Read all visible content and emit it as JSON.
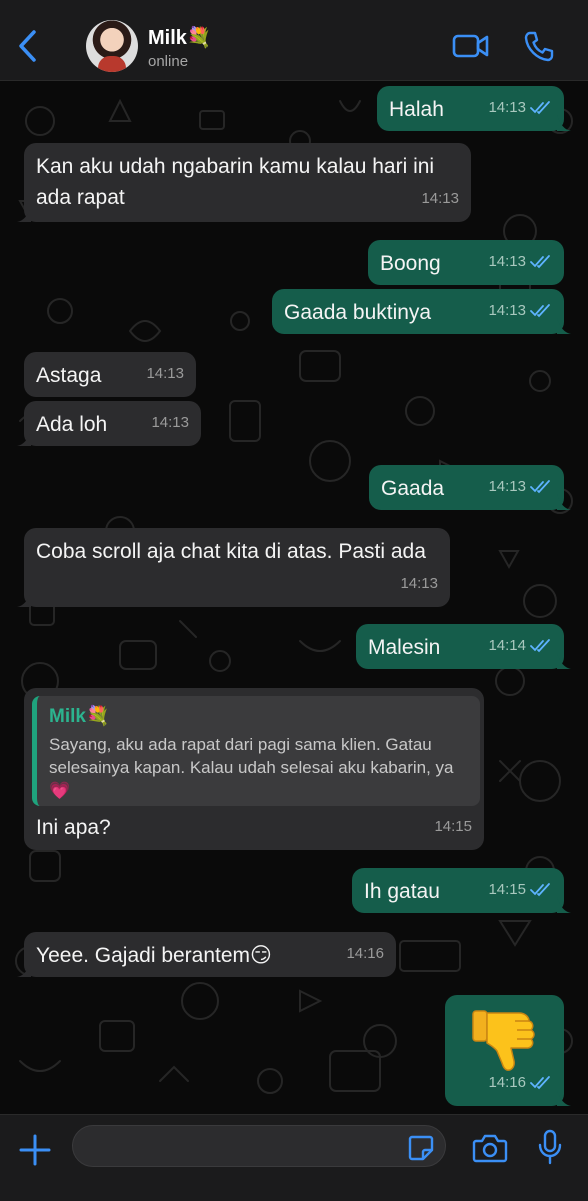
{
  "header": {
    "contact_name": "Milk💐",
    "status": "online",
    "back_icon": "chevron-left-icon",
    "video_icon": "video-camera-icon",
    "call_icon": "phone-icon"
  },
  "colors": {
    "accent": "#3b8ff5",
    "outgoing_bubble": "#155d4b",
    "incoming_bubble": "#2c2c2e",
    "read_ticks": "#5eb3ff"
  },
  "messages": [
    {
      "dir": "out",
      "text": "Halah",
      "time": "14:13"
    },
    {
      "dir": "in",
      "text": "Kan aku udah ngabarin kamu kalau hari ini ada rapat",
      "time": "14:13"
    },
    {
      "dir": "out",
      "text": "Boong",
      "time": "14:13"
    },
    {
      "dir": "out",
      "text": "Gaada buktinya",
      "time": "14:13"
    },
    {
      "dir": "in",
      "text": "Astaga",
      "time": "14:13"
    },
    {
      "dir": "in",
      "text": "Ada loh",
      "time": "14:13"
    },
    {
      "dir": "out",
      "text": "Gaada",
      "time": "14:13"
    },
    {
      "dir": "in",
      "text": "Coba scroll aja chat kita di atas. Pasti ada",
      "time": "14:13"
    },
    {
      "dir": "out",
      "text": "Malesin",
      "time": "14:14"
    },
    {
      "dir": "in",
      "text": "Ini apa?",
      "time": "14:15",
      "quote": {
        "author": "Milk💐",
        "text": "Sayang, aku ada rapat dari pagi sama klien. Gatau selesainya kapan. Kalau udah selesai aku kabarin, ya💗"
      }
    },
    {
      "dir": "out",
      "text": "Ih gatau",
      "time": "14:15"
    },
    {
      "dir": "in",
      "text": "Yeee. Gajadi berantem😏",
      "time": "14:16"
    },
    {
      "dir": "out",
      "text": "",
      "emoji": "thumbs-down-icon",
      "time": "14:16"
    }
  ],
  "input": {
    "placeholder": "",
    "value": "",
    "plus_icon": "plus-icon",
    "sticker_icon": "sticker-icon",
    "camera_icon": "camera-icon",
    "mic_icon": "microphone-icon"
  }
}
